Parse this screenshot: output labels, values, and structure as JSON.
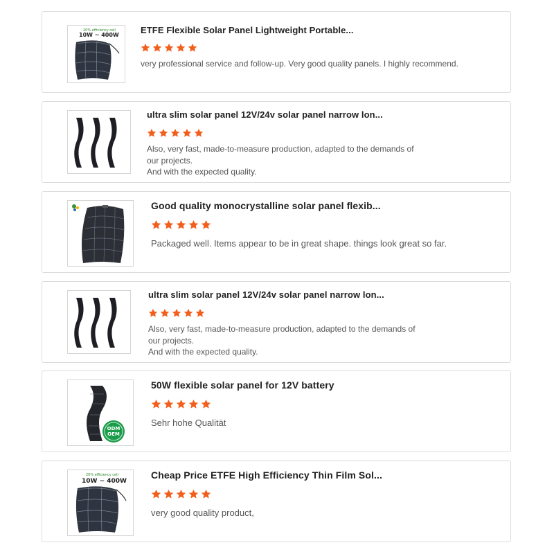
{
  "colors": {
    "star": "#f25f1c",
    "border": "#dcdcdc",
    "title": "#222222",
    "comment": "#555555"
  },
  "reviews": [
    {
      "title": "ETFE Flexible Solar Panel Lightweight Portable...",
      "rating": 5,
      "comment_lines": [
        "very professional service and follow-up. Very good quality panels. I highly recommend."
      ],
      "image": "curved-solar-panel",
      "image_text": {
        "efficiency": "20% efficiency cell",
        "range": "10W ~ 400W"
      }
    },
    {
      "title": "ultra slim solar panel 12V/24v solar panel narrow lon...",
      "rating": 5,
      "comment_lines": [
        "Also, very fast, made-to-measure production, adapted to the demands of",
        "our projects.",
        "And with the expected quality."
      ],
      "image": "three-slim-panels"
    },
    {
      "title": "Good quality monocrystalline solar panel flexib...",
      "rating": 5,
      "comment_lines": [
        "Packaged well. Items appear to be in great shape. things look great so far."
      ],
      "image": "flexible-panel-logo"
    },
    {
      "title": "ultra slim solar panel 12V/24v solar panel narrow lon...",
      "rating": 5,
      "comment_lines": [
        "Also, very fast, made-to-measure production, adapted to the demands of",
        "our projects.",
        "And with the expected quality."
      ],
      "image": "three-slim-panels"
    },
    {
      "title": "50W flexible solar panel for 12V battery",
      "rating": 5,
      "comment_lines": [
        "Sehr hohe Qualität"
      ],
      "image": "s-curve-panel-odm",
      "image_text": {
        "badge_line1": "ODM",
        "badge_line2": "OEM"
      }
    },
    {
      "title": "Cheap Price ETFE High Efficiency Thin Film Sol...",
      "rating": 5,
      "comment_lines": [
        "very good quality product,"
      ],
      "image": "curved-solar-panel",
      "image_text": {
        "efficiency": "20% efficiency cell",
        "range": "10W ~ 400W"
      }
    }
  ]
}
